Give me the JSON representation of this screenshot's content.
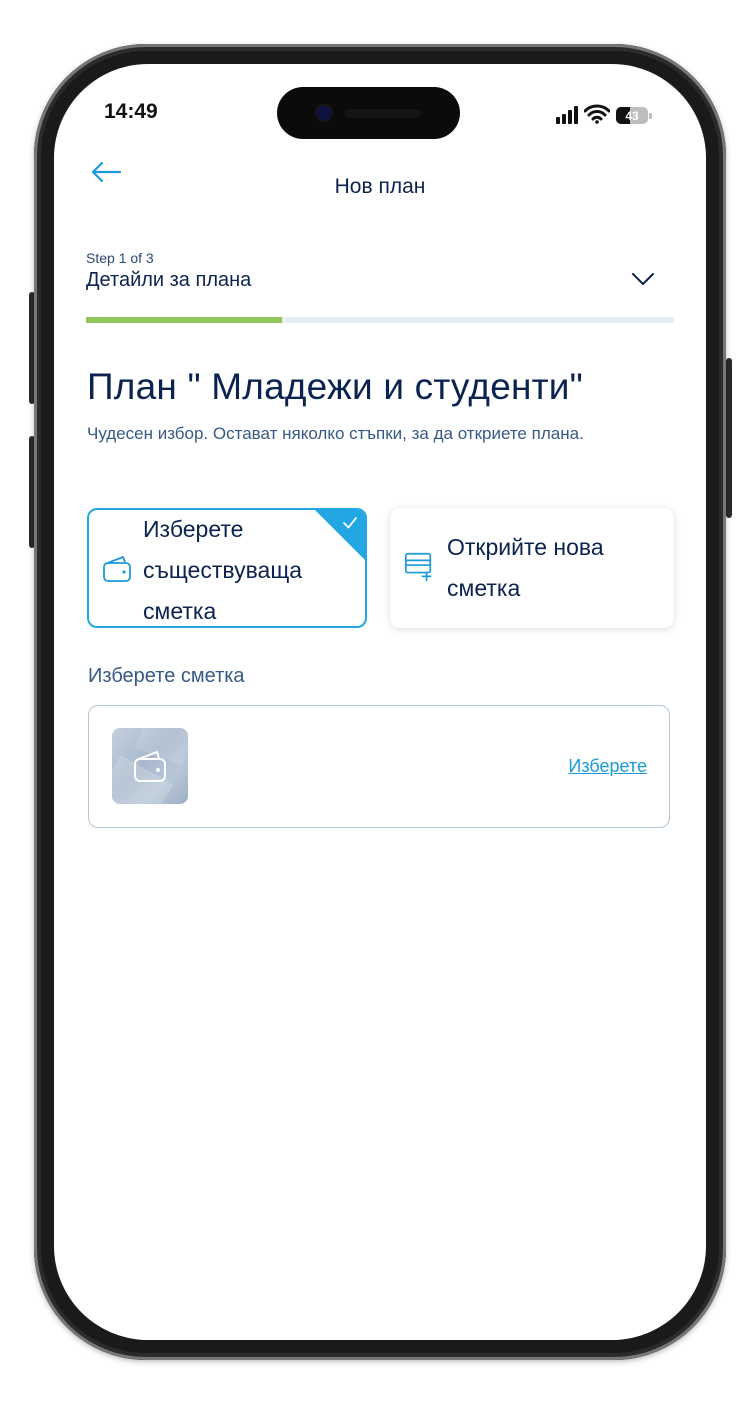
{
  "status_bar": {
    "time": "14:49",
    "battery_percent": "43",
    "battery_level": 0.43,
    "icons": [
      "signal-icon",
      "wifi-icon",
      "battery-icon"
    ]
  },
  "header": {
    "title": "Нов план",
    "back_icon": "arrow-left-icon"
  },
  "stepper": {
    "step_label": "Step 1 of 3",
    "title": "Детайли за плана",
    "expand_icon": "chevron-down-icon",
    "progress": 0.333
  },
  "plan": {
    "title": "План \" Младежи и студенти\"",
    "subtitle": "Чудесен избор. Остават няколко стъпки, за да откриете плана."
  },
  "options": [
    {
      "label": "Изберете съществуваща сметка",
      "icon": "wallet-icon",
      "selected": true
    },
    {
      "label": "Открийте нова сметка",
      "icon": "card-add-icon",
      "selected": false
    }
  ],
  "account_select": {
    "section_label": "Изберете сметка",
    "avatar_icon": "wallet-icon",
    "link_label": "Изберете"
  },
  "colors": {
    "primary_text": "#0b2350",
    "secondary_text": "#355a86",
    "accent": "#22a7e4",
    "link": "#1a9bd7",
    "progress": "#8fc75a"
  }
}
